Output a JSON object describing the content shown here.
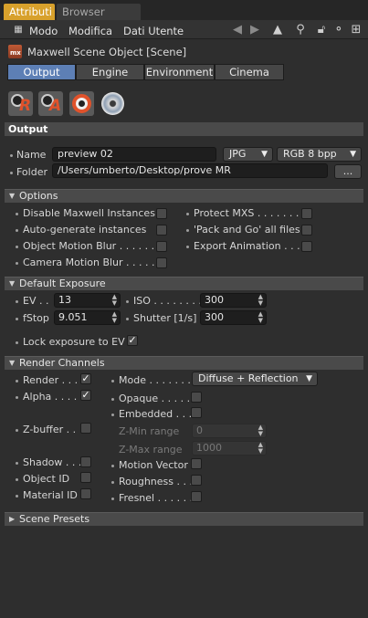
{
  "tabs": {
    "active": "Attributi",
    "inactive": "Browser Livello"
  },
  "menu": {
    "mode": "Modo",
    "edit": "Modifica",
    "user_data": "Dati Utente"
  },
  "object": {
    "logo_text": "mx",
    "title": "Maxwell Scene Object [Scene]"
  },
  "subtabs": [
    "Output",
    "Engine",
    "Environment",
    "Cinema"
  ],
  "render_icons": {
    "r": "R",
    "a": "A"
  },
  "output": {
    "header": "Output",
    "name_label": "Name",
    "name_value": "preview 02",
    "format": "JPG",
    "depth": "RGB 8 bpp",
    "folder_label": "Folder",
    "folder_value": "/Users/umberto/Desktop/prove MR",
    "browse": "..."
  },
  "options": {
    "header": "Options",
    "items": [
      {
        "label": "Disable Maxwell Instances",
        "checked": false
      },
      {
        "label": "Protect MXS . . . . . . . .",
        "checked": false
      },
      {
        "label": "Auto-generate instances",
        "checked": false
      },
      {
        "label": "'Pack and Go' all files",
        "checked": false
      },
      {
        "label": "Object Motion Blur . . . . . . .",
        "checked": false
      },
      {
        "label": "Export Animation . . .",
        "checked": false
      },
      {
        "label": "Camera Motion Blur . . . . . .",
        "checked": false
      }
    ]
  },
  "exposure": {
    "header": "Default Exposure",
    "ev_label": "EV . .",
    "ev_value": "13",
    "iso_label": "ISO . . . . . . . . .",
    "iso_value": "300",
    "fstop_label": "fStop",
    "fstop_value": "9.051",
    "shutter_label": "Shutter [1/s]",
    "shutter_value": "300",
    "lock_label": "Lock exposure to EV",
    "lock_checked": true
  },
  "channels": {
    "header": "Render Channels",
    "render_label": "Render . . .",
    "render_checked": true,
    "alpha_label": "Alpha . . . .",
    "alpha_checked": true,
    "zbuffer_label": "Z-buffer . .",
    "shadow_label": "Shadow . . .",
    "objectid_label": "Object ID",
    "materialid_label": "Material ID",
    "mode_label": "Mode . . . . . . . . .",
    "mode_value": "Diffuse + Reflection",
    "opaque_label": "Opaque . . . . .",
    "embedded_label": "Embedded . . .",
    "zmin_label": "Z-Min range",
    "zmin_value": "0",
    "zmax_label": "Z-Max range",
    "zmax_value": "1000",
    "motion_label": "Motion Vector",
    "roughness_label": "Roughness . . .",
    "fresnel_label": "Fresnel . . . . . ."
  },
  "presets": {
    "header": "Scene Presets"
  },
  "colors": {
    "accent": "#d8a12c",
    "tab_selected": "#5d7fb5",
    "panel": "#2e2e2e"
  }
}
